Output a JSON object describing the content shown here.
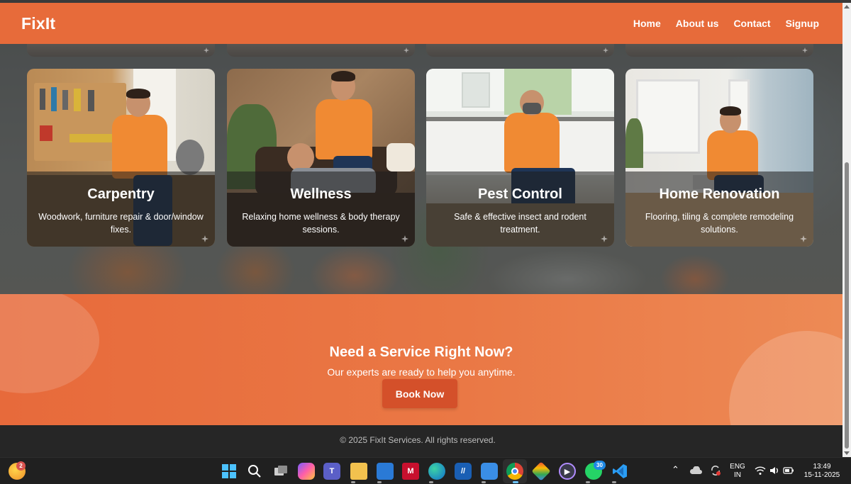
{
  "header": {
    "logo": "FixIt",
    "nav": [
      "Home",
      "About us",
      "Contact",
      "Signup"
    ]
  },
  "services": [
    {
      "title": "Carpentry",
      "description": "Woodwork, furniture repair & door/window fixes."
    },
    {
      "title": "Wellness",
      "description": "Relaxing home wellness & body therapy sessions."
    },
    {
      "title": "Pest Control",
      "description": "Safe & effective insect and rodent treatment."
    },
    {
      "title": "Home Renovation",
      "description": "Flooring, tiling & complete remodeling solutions."
    }
  ],
  "cta": {
    "title": "Need a Service Right Now?",
    "subtitle": "Our experts are ready to help you anytime.",
    "button": "Book Now"
  },
  "footer": {
    "copyright": "© 2025 FixIt Services. All rights reserved."
  },
  "taskbar": {
    "weather_badge": "2",
    "whatsapp_badge": "30",
    "language_top": "ENG",
    "language_bottom": "IN",
    "time": "13:49",
    "date": "15-11-2025"
  },
  "colors": {
    "brand": "#e76b3a",
    "button": "#d4502a",
    "footer": "#262626"
  }
}
